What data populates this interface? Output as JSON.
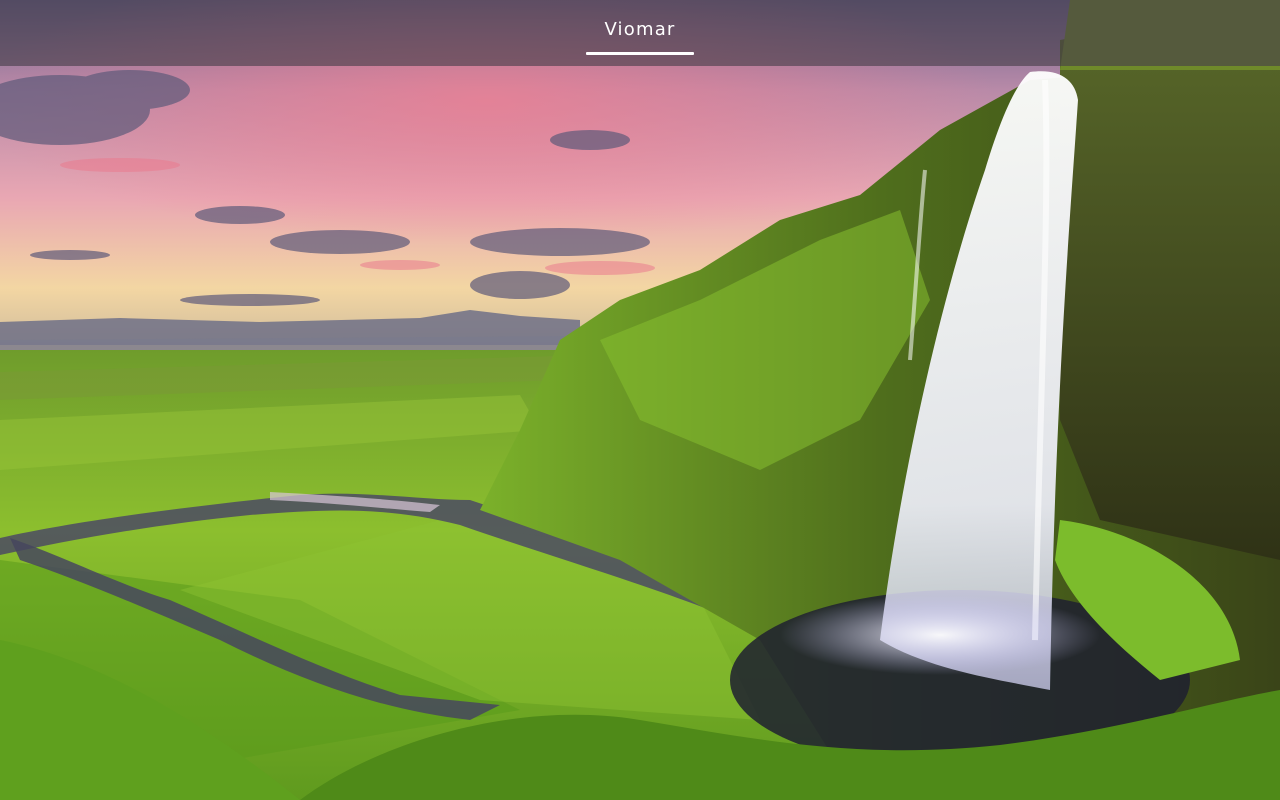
{
  "header": {
    "brand_name": "Viomar",
    "brand_active": true
  },
  "hero": {
    "image": "landscape-waterfall-photo",
    "colors": {
      "sky_top": "#5f5a86",
      "sky_pink": "#e98aa0",
      "horizon": "#f2d9a0",
      "grass": "#7fb82c",
      "cliff": "#3f4a1c",
      "water": "#ffffff"
    }
  }
}
